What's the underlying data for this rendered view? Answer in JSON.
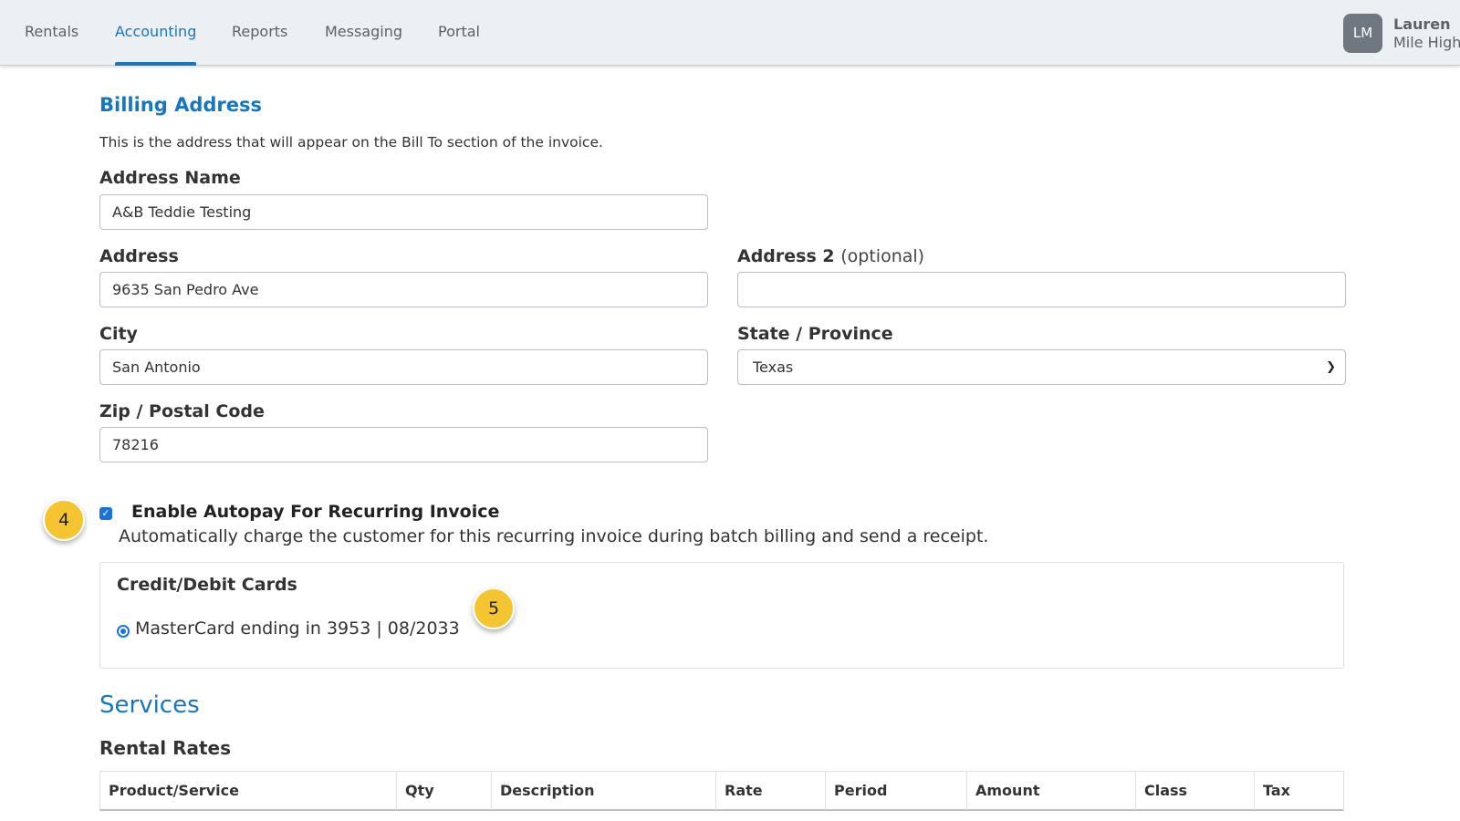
{
  "nav": {
    "items": [
      "Rentals",
      "Accounting",
      "Reports",
      "Messaging",
      "Portal"
    ],
    "active": "Accounting"
  },
  "user": {
    "initials": "LM",
    "name": "Lauren",
    "org": "Mile High"
  },
  "billing": {
    "title": "Billing Address",
    "description": "This is the address that will appear on the Bill To section of the invoice.",
    "address_name": {
      "label": "Address Name",
      "value": "A&B Teddie Testing"
    },
    "address": {
      "label": "Address",
      "value": "9635 San Pedro Ave"
    },
    "address2": {
      "label": "Address 2",
      "optional": "(optional)",
      "value": ""
    },
    "city": {
      "label": "City",
      "value": "San Antonio"
    },
    "state": {
      "label": "State / Province",
      "value": "Texas"
    },
    "zip": {
      "label": "Zip / Postal Code",
      "value": "78216"
    }
  },
  "autopay": {
    "checked": true,
    "label": "Enable Autopay For Recurring Invoice",
    "help": "Automatically charge the customer for this recurring invoice during batch billing and send a receipt."
  },
  "cards": {
    "title": "Credit/Debit Cards",
    "selected": "MasterCard ending in 3953 | 08/2033"
  },
  "markers": [
    "4",
    "5"
  ],
  "services": {
    "title": "Services",
    "subtitle": "Rental Rates",
    "columns": [
      "Product/Service",
      "Qty",
      "Description",
      "Rate",
      "Period",
      "Amount",
      "Class",
      "Tax"
    ]
  },
  "colors": {
    "accent": "#1676c0",
    "marker": "#f5c431",
    "checkbox": "#1a73d9"
  }
}
